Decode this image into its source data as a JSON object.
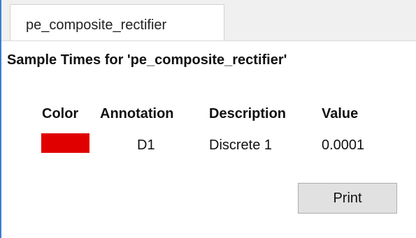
{
  "tab": {
    "label": "pe_composite_rectifier"
  },
  "title": "Sample Times for 'pe_composite_rectifier'",
  "table": {
    "headers": {
      "color": "Color",
      "annotation": "Annotation",
      "description": "Description",
      "value": "Value"
    },
    "rows": [
      {
        "color": "#e00000",
        "annotation": "D1",
        "description": "Discrete 1",
        "value": "0.0001"
      }
    ]
  },
  "buttons": {
    "print_label": "Print"
  }
}
